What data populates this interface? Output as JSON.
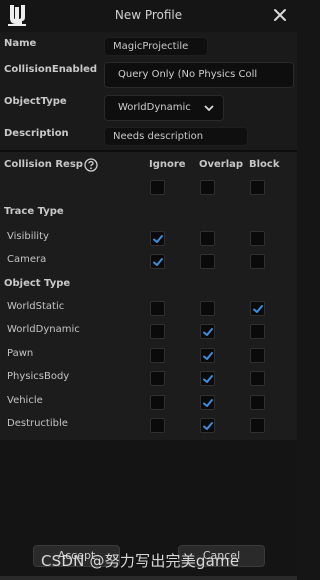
{
  "window": {
    "title": "New Profile"
  },
  "form": {
    "name_label": "Name",
    "name_value": "MagicProjectile",
    "collision_label": "CollisionEnabled",
    "collision_value": "Query Only (No Physics Coll",
    "objecttype_label": "ObjectType",
    "objecttype_value": "WorldDynamic",
    "description_label": "Description",
    "description_value": "Needs description"
  },
  "response": {
    "header_label": "Collision Resp",
    "columns": [
      "Ignore",
      "Overlap",
      "Block"
    ],
    "trace_type_label": "Trace Type",
    "object_type_label": "Object Type",
    "trace_rows": [
      {
        "label": "Visibility",
        "checks": [
          true,
          false,
          false
        ]
      },
      {
        "label": "Camera",
        "checks": [
          true,
          false,
          false
        ]
      }
    ],
    "object_rows": [
      {
        "label": "WorldStatic",
        "checks": [
          false,
          false,
          true
        ]
      },
      {
        "label": "WorldDynamic",
        "checks": [
          false,
          true,
          false
        ]
      },
      {
        "label": "Pawn",
        "checks": [
          false,
          true,
          false
        ]
      },
      {
        "label": "PhysicsBody",
        "checks": [
          false,
          true,
          false
        ]
      },
      {
        "label": "Vehicle",
        "checks": [
          false,
          true,
          false
        ]
      },
      {
        "label": "Destructible",
        "checks": [
          false,
          true,
          false
        ]
      }
    ]
  },
  "footer": {
    "accept_label": "Accept",
    "cancel_label": "Cancel",
    "watermark": "CSDN @努力写出完美game"
  },
  "colors": {
    "check": "#3b8fe0",
    "background": "#151515"
  }
}
